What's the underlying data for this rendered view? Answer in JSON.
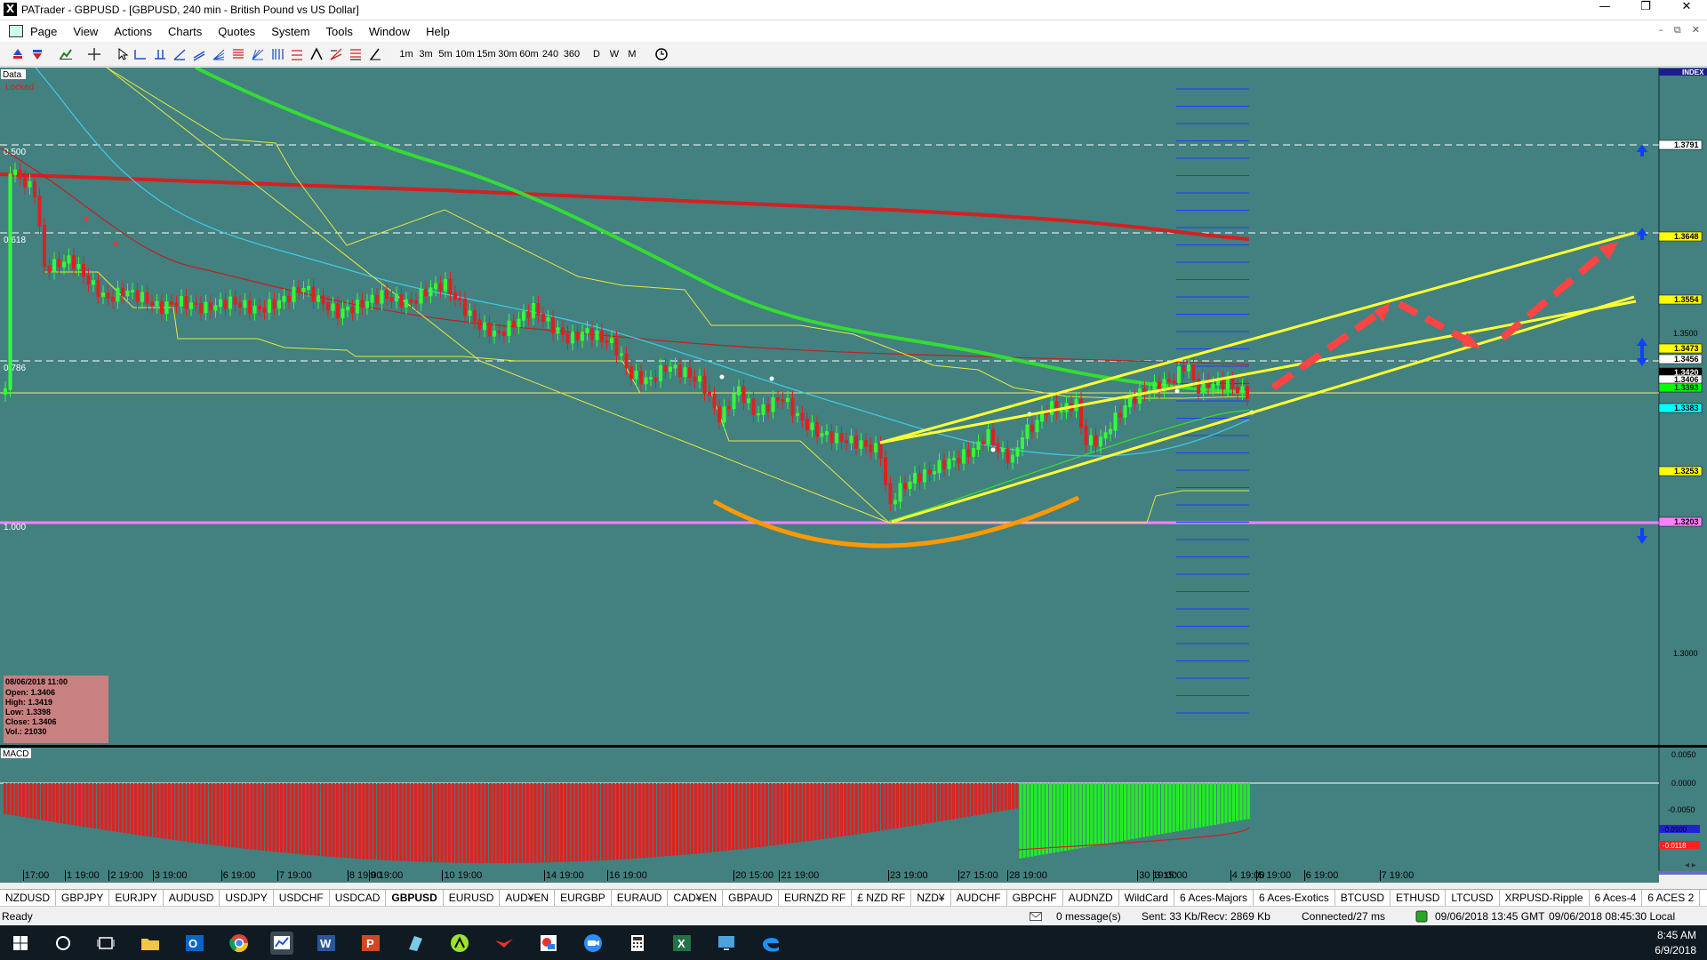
{
  "window": {
    "icon": "X",
    "title": "PATrader - GBPUSD - [GBPUSD, 240 min - British Pound vs US Dollar]",
    "controls": [
      "—",
      "❐",
      "✕"
    ]
  },
  "menu": {
    "items": [
      "Page",
      "View",
      "Actions",
      "Charts",
      "Quotes",
      "System",
      "Tools",
      "Window",
      "Help"
    ],
    "mdi_controls": [
      "–",
      "⧉",
      "✕"
    ]
  },
  "toolbar": {
    "timeframes": [
      "1m",
      "3m",
      "5m",
      "10m",
      "15m",
      "30m",
      "60m",
      "240",
      "360",
      "D",
      "W",
      "M"
    ]
  },
  "chart": {
    "data_label": "Data",
    "locked_label": "Locked",
    "fib_labels": [
      "0.500",
      "0.618",
      "0.786",
      "1.000"
    ],
    "index_label": "INDEX",
    "price_ticks": [
      "1.3500",
      "1.3000"
    ],
    "price_badges": [
      {
        "text": "1.3791",
        "bg": "#ffffff"
      },
      {
        "text": "1.3648",
        "bg": "#ffff00"
      },
      {
        "text": "1.3554",
        "bg": "#ffff00"
      },
      {
        "text": "1.3473",
        "bg": "#ffff00"
      },
      {
        "text": "1.3456",
        "bg": "#ffffff"
      },
      {
        "text": "1.3420",
        "bg": "#000000"
      },
      {
        "text": "1.3406",
        "bg": "#ffffff"
      },
      {
        "text": "1.3393",
        "bg": "#00ff00"
      },
      {
        "text": "1.3383",
        "bg": "#00ffff"
      },
      {
        "text": "1.3253",
        "bg": "#ffff00"
      },
      {
        "text": "1.3203",
        "bg": "#ff80ff"
      }
    ],
    "info_box": {
      "date": "08/06/2018 11:00",
      "open": "Open: 1.3406",
      "high": "High: 1.3419",
      "low": "Low: 1.3398",
      "close": "Close: 1.3406",
      "vol": "Vol.: 21030"
    },
    "colors": {
      "background": "#438080",
      "bull_candle": "#33ff33",
      "bear_candle": "#e02020",
      "ma_red": "#d42020",
      "ma_green": "#33dd33",
      "ma_cyan": "#40c8e0",
      "channel": "#ffff33",
      "projection": "#ff4444",
      "cup": "#ff9900",
      "fib_1000": "#ff80ff"
    }
  },
  "macd": {
    "label": "MACD",
    "ticks": [
      "0.0050",
      "0.0000",
      "-0.0050"
    ],
    "badges": [
      "-0.0100",
      "-0.0118"
    ]
  },
  "time_axis": {
    "labels": [
      "17:00",
      "1 19:00",
      "2 19:00",
      "3 19:00",
      "6 19:00",
      "7 19:00",
      "8 19:00",
      "9 19:00",
      "10 19:00",
      "14 19:00",
      "16 19:00",
      "20 15:00",
      "21 19:00",
      "23 19:00",
      "27 15:00",
      "28 19:00",
      "30 19:00",
      "3 15:00",
      "4 19:00",
      "5 19:00",
      "6 19:00",
      "7 19:00"
    ]
  },
  "symbol_tabs": {
    "items": [
      "NZDUSD",
      "GBPJPY",
      "EURJPY",
      "AUDUSD",
      "USDJPY",
      "USDCHF",
      "USDCAD",
      "GBPUSD",
      "EURUSD",
      "AUD¥EN",
      "EURGBP",
      "EURAUD",
      "CAD¥EN",
      "GBPAUD",
      "EURNZD RF",
      "£ NZD RF",
      "NZD¥",
      "AUDCHF",
      "GBPCHF",
      "AUDNZD",
      "WildCard",
      "6 Aces-Majors",
      "6 Aces-Exotics",
      "BTCUSD",
      "ETHUSD",
      "LTCUSD",
      "XRPUSD-Ripple",
      "6 Aces-4",
      "6 ACES 2"
    ],
    "active": "GBPUSD"
  },
  "status": {
    "ready": "Ready",
    "messages": "0 message(s)",
    "traffic": "Sent: 33 Kb/Recv: 2869 Kb",
    "connection": "Connected/27 ms",
    "gmt_time": "09/06/2018 13:45 GMT",
    "local_time": "09/06/2018 08:45:30 Local"
  },
  "taskbar": {
    "time": "8:45 AM",
    "date": "6/9/2018"
  }
}
